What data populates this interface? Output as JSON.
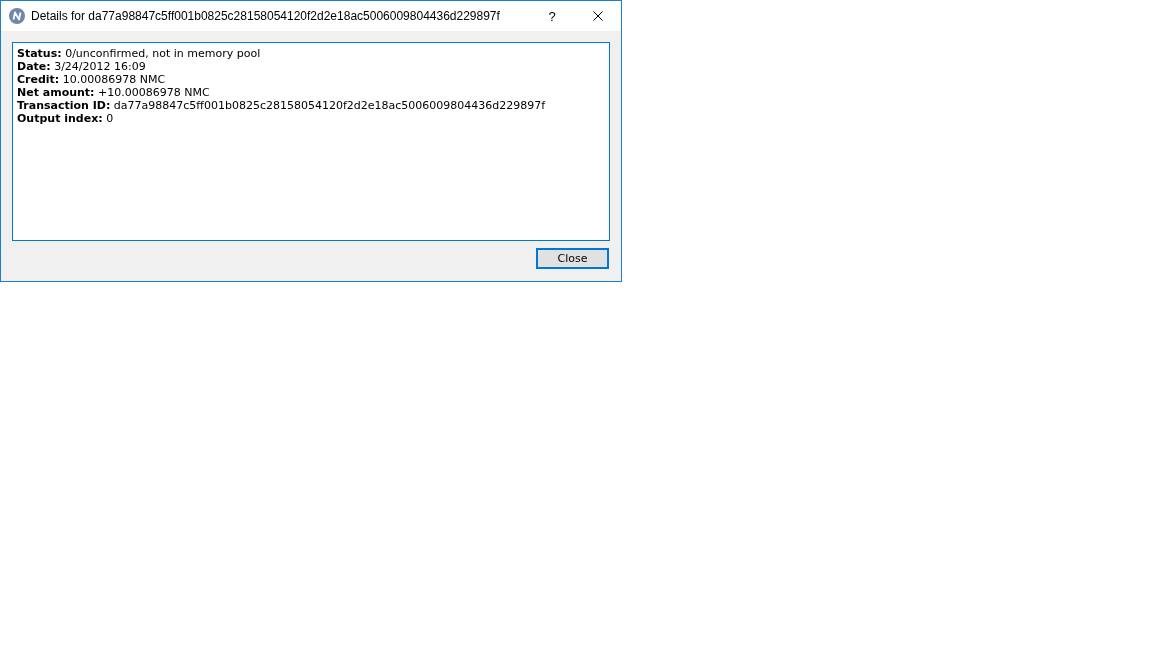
{
  "window": {
    "title": "Details for da77a98847c5ff001b0825c28158054120f2d2e18ac5006009804436d229897f",
    "help_button": "?"
  },
  "details": [
    {
      "label": "Status:",
      "value": "0/unconfirmed, not in memory pool"
    },
    {
      "label": "Date:",
      "value": "3/24/2012 16:09"
    },
    {
      "label": "Credit:",
      "value": "10.00086978 NMC"
    },
    {
      "label": "Net amount:",
      "value": "+10.00086978 NMC"
    },
    {
      "label": "Transaction ID:",
      "value": "da77a98847c5ff001b0825c28158054120f2d2e18ac5006009804436d229897f"
    },
    {
      "label": "Output index:",
      "value": "0"
    }
  ],
  "buttons": [
    {
      "label": "Close",
      "default": true
    }
  ]
}
